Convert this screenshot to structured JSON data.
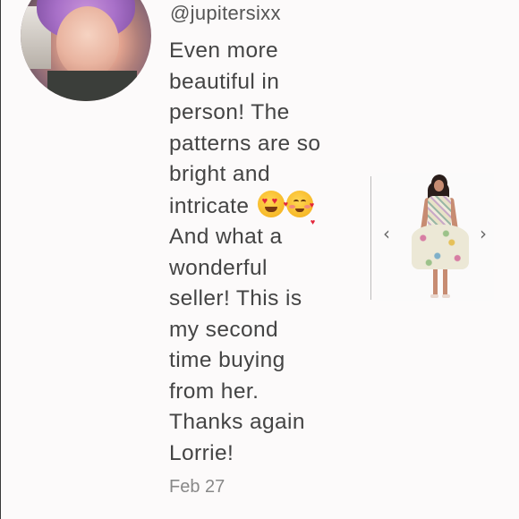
{
  "comment": {
    "username": "@jupitersixx",
    "lines": [
      "Even more",
      "beautiful in",
      "person! The",
      "patterns are so",
      "bright and",
      "intricate",
      "And what a",
      "wonderful",
      "seller! This is",
      "my second",
      "time buying",
      "from her.",
      "Thanks again",
      "Lorrie!"
    ],
    "emojis": [
      "smiling-face-with-heart-eyes",
      "smiling-face-with-hearts"
    ],
    "timestamp": "Feb 27"
  },
  "carousel": {
    "prev_icon": "‹",
    "next_icon": "›"
  }
}
